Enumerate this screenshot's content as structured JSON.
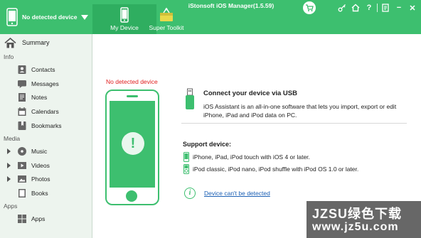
{
  "app": {
    "title": "iStonsoft iOS Manager(1.5.59)",
    "device_selector": "No detected device"
  },
  "tabs": [
    {
      "label": "My Device",
      "active": true
    },
    {
      "label": "Super Toolkit",
      "active": false
    }
  ],
  "window_controls": [
    "cart-icon",
    "key-icon",
    "home-icon",
    "help-icon",
    "register-icon",
    "minimize-icon",
    "close-icon"
  ],
  "window_glyphs": {
    "help": "?",
    "minimize": "−",
    "close": "✕"
  },
  "sidebar": {
    "summary": "Summary",
    "sections": [
      {
        "title": "Info",
        "items": [
          "Contacts",
          "Messages",
          "Notes",
          "Calendars",
          "Bookmarks"
        ]
      },
      {
        "title": "Media",
        "items": [
          "Music",
          "Videos",
          "Photos",
          "Books"
        ]
      },
      {
        "title": "Apps",
        "items": [
          "Apps"
        ]
      }
    ]
  },
  "main": {
    "no_device_label": "No detected device",
    "alert_glyph": "!",
    "connect_title": "Connect your device via USB",
    "connect_desc": "iOS Assistant is an all-in-one software that lets you import, export or edit iPhone, iPad and iPod data on PC.",
    "support_title": "Support device:",
    "support_items": [
      "iPhone, iPad, iPod touch with iOS 4 or later.",
      "iPod classic, iPod nano, iPod shuffle with iPod OS 1.0 or later."
    ],
    "help_glyph": "i",
    "help_link": "Device can't be detected"
  },
  "watermark": {
    "line1": "JZSU绿色下载",
    "line2": "www.jz5u.com"
  },
  "colors": {
    "accent": "#3dbf6f",
    "accent_dark": "#2fae60",
    "alert": "#e02020",
    "link": "#1a5fb4"
  }
}
